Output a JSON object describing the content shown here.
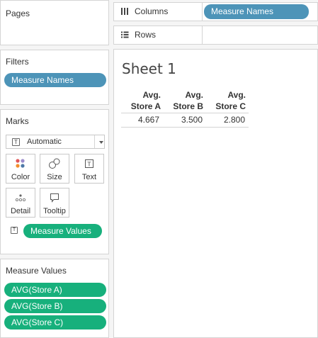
{
  "pages": {
    "title": "Pages"
  },
  "filters": {
    "title": "Filters",
    "pills": [
      "Measure Names"
    ]
  },
  "marks": {
    "title": "Marks",
    "mark_type": "Automatic",
    "buttons": {
      "color": "Color",
      "size": "Size",
      "text": "Text",
      "detail": "Detail",
      "tooltip": "Tooltip"
    },
    "text_pill": "Measure Values"
  },
  "measure_values": {
    "title": "Measure Values",
    "pills": [
      "AVG(Store A)",
      "AVG(Store B)",
      "AVG(Store C)"
    ]
  },
  "shelves": {
    "columns": {
      "label": "Columns",
      "pill": "Measure Names"
    },
    "rows": {
      "label": "Rows"
    }
  },
  "sheet": {
    "title": "Sheet 1",
    "headers": [
      {
        "line1": "Avg.",
        "line2": "Store A"
      },
      {
        "line1": "Avg.",
        "line2": "Store B"
      },
      {
        "line1": "Avg.",
        "line2": "Store C"
      }
    ],
    "values": [
      "4.667",
      "3.500",
      "2.800"
    ]
  },
  "colors": {
    "dimension_pill": "#4d94b8",
    "measure_pill": "#17b07c"
  }
}
